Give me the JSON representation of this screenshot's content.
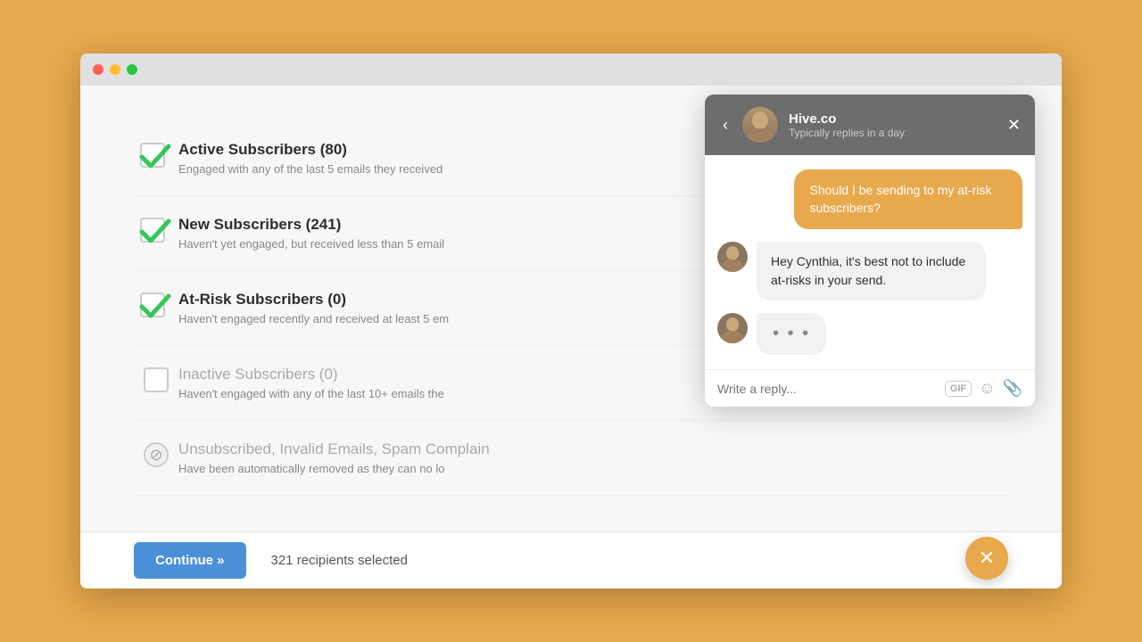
{
  "browser": {
    "titlebar": {
      "lights": [
        "red",
        "yellow",
        "green"
      ]
    }
  },
  "subscribers": {
    "items": [
      {
        "id": "active",
        "name": "Active Subscribers (80)",
        "desc": "Engaged with any of the last 5 emails they received",
        "state": "checked"
      },
      {
        "id": "new",
        "name": "New Subscribers (241)",
        "desc": "Haven't yet engaged, but received less than 5 email",
        "state": "checked"
      },
      {
        "id": "at-risk",
        "name": "At-Risk Subscribers (0)",
        "desc": "Haven't engaged recently and received at least 5 em",
        "state": "checked"
      },
      {
        "id": "inactive",
        "name": "Inactive Subscribers (0)",
        "desc": "Haven't engaged with any of the last 10+ emails the",
        "state": "empty"
      },
      {
        "id": "unsubscribed",
        "name": "Unsubscribed, Invalid Emails, Spam Complain",
        "desc": "Have been automatically removed as they can no lo",
        "state": "disabled"
      }
    ]
  },
  "footer": {
    "continue_label": "Continue »",
    "recipients_text": "321 recipients selected"
  },
  "chat": {
    "header": {
      "name": "Hive.co",
      "status": "Typically replies in a day"
    },
    "messages": [
      {
        "type": "outgoing",
        "text": "Should I be sending to my at-risk subscribers?"
      },
      {
        "type": "incoming",
        "text": "Hey Cynthia, it's best not to include at-risks in your send."
      },
      {
        "type": "typing",
        "text": "•••"
      }
    ],
    "input_placeholder": "Write a reply...",
    "gif_label": "GIF"
  }
}
